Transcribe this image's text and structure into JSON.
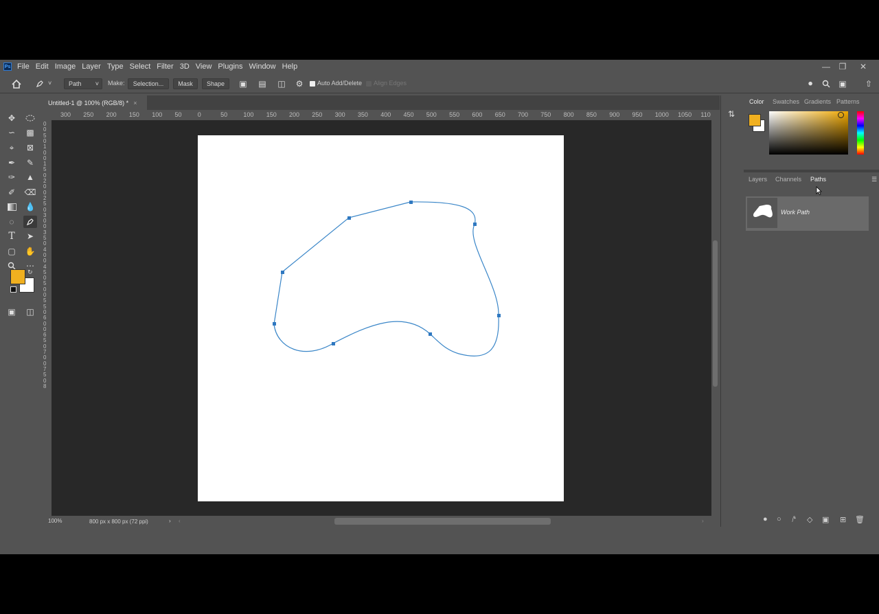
{
  "menu": [
    "File",
    "Edit",
    "Image",
    "Layer",
    "Type",
    "Select",
    "Filter",
    "3D",
    "View",
    "Plugins",
    "Window",
    "Help"
  ],
  "app_logo": "Ps",
  "options": {
    "mode": "Path",
    "make_label": "Make:",
    "selection_btn": "Selection...",
    "mask_btn": "Mask",
    "shape_btn": "Shape",
    "auto_add_delete": "Auto Add/Delete",
    "align_edges": "Align Edges"
  },
  "document": {
    "tab_title": "Untitled-1 @ 100% (RGB/8) *",
    "zoom": "100%",
    "doc_info": "800 px x 800 px (72 ppi)"
  },
  "ruler": {
    "h_labels": [
      "300",
      "250",
      "200",
      "150",
      "100",
      "50",
      "0",
      "50",
      "100",
      "150",
      "200",
      "250",
      "300",
      "350",
      "400",
      "450",
      "500",
      "550",
      "600",
      "650",
      "700",
      "750",
      "800",
      "850",
      "900",
      "950",
      "1000",
      "1050",
      "110"
    ],
    "v_labels": [
      "0",
      "0",
      "5",
      "0",
      "1",
      "0",
      "0",
      "1",
      "5",
      "0",
      "2",
      "0",
      "0",
      "2",
      "5",
      "0",
      "3",
      "0",
      "0",
      "3",
      "5",
      "0",
      "4",
      "0",
      "0",
      "4",
      "5",
      "0",
      "5",
      "0",
      "0",
      "5",
      "5",
      "0",
      "6",
      "0",
      "0",
      "6",
      "5",
      "0",
      "7",
      "0",
      "0",
      "7",
      "5",
      "0",
      "8"
    ]
  },
  "panels": {
    "color_tabs": [
      "Color",
      "Swatches",
      "Gradients",
      "Patterns"
    ],
    "layers_tabs": [
      "Layers",
      "Channels",
      "Paths"
    ],
    "work_path": "Work Path"
  },
  "colors": {
    "foreground": "#f0b020",
    "background": "#ffffff",
    "path_stroke": "#3a86c8",
    "anchor": "#2f78c0"
  }
}
